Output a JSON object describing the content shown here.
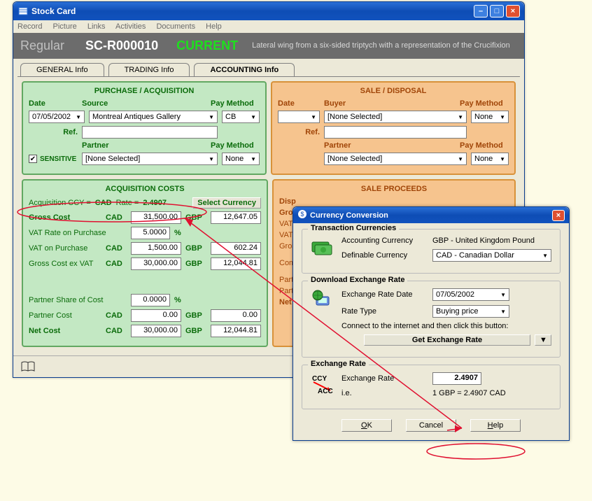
{
  "main_window": {
    "title": "Stock Card",
    "menu": [
      "Record",
      "Picture",
      "Links",
      "Activities",
      "Documents",
      "Help"
    ],
    "header": {
      "regular": "Regular",
      "code": "SC-R000010",
      "status": "CURRENT",
      "description": "Lateral wing from a six-sided triptych with a representation of the Crucifixion"
    },
    "tabs": [
      {
        "label": "GENERAL Info"
      },
      {
        "label": "TRADING Info"
      },
      {
        "label": "ACCOUNTING Info"
      }
    ],
    "purchase_panel": {
      "title": "PURCHASE / ACQUISITION",
      "date_lbl": "Date",
      "date_val": "07/05/2002",
      "source_lbl": "Source",
      "source_val": "Montreal Antiques Gallery",
      "paymethod_lbl": "Pay Method",
      "paymethod_val": "CB",
      "ref_lbl": "Ref.",
      "ref_val": "",
      "partner_lbl": "Partner",
      "partner_val": "[None Selected]",
      "paymethod2_val": "None",
      "sensitive_lbl": "SENSITIVE",
      "sensitive_checked": true
    },
    "sale_panel": {
      "title": "SALE / DISPOSAL",
      "date_lbl": "Date",
      "date_val": "",
      "buyer_lbl": "Buyer",
      "buyer_val": "[None Selected]",
      "paymethod_lbl": "Pay Method",
      "paymethod_val": "None",
      "ref_lbl": "Ref.",
      "ref_val": "",
      "partner_lbl": "Partner",
      "partner_val": "[None Selected]",
      "paymethod2_val": "None"
    },
    "acq_costs": {
      "title": "ACQUISITION COSTS",
      "rate_line_lbl1": "Acquisition CCY  =",
      "rate_ccy": "CAD",
      "rate_line_lbl2": "Rate  =",
      "rate_val": "2.4907",
      "select_btn": "Select Currency",
      "gross_cost_lbl": "Gross Cost",
      "ccy1": "CAD",
      "gross_cost_cad": "31,500.00",
      "ccy2": "GBP",
      "gross_cost_gbp": "12,647.05",
      "vat_rate_lbl": "VAT Rate on Purchase",
      "vat_rate_val": "5.0000",
      "pct": "%",
      "vat_on_lbl": "VAT on Purchase",
      "vat_on_cad": "1,500.00",
      "vat_on_gbp": "602.24",
      "gross_ex_lbl": "Gross Cost ex VAT",
      "gross_ex_cad": "30,000.00",
      "gross_ex_gbp": "12,044.81",
      "partner_share_lbl": "Partner Share of Cost",
      "partner_share_val": "0.0000",
      "partner_cost_lbl": "Partner Cost",
      "partner_cost_cad": "0.00",
      "partner_cost_gbp": "0.00",
      "net_cost_lbl": "Net Cost",
      "net_cost_cad": "30,000.00",
      "net_cost_gbp": "12,044.81"
    },
    "sale_proceeds": {
      "title": "SALE PROCEEDS",
      "disp_lbl": "Disp",
      "gross_lbl": "Gros",
      "vat_lbl": "VAT",
      "vat2_lbl": "VAT",
      "gross2_lbl": "Gros",
      "com_lbl": "Com",
      "part_lbl": "Part",
      "part2_lbl": "Part",
      "net_lbl": "Net"
    }
  },
  "dialog": {
    "title": "Currency Conversion",
    "fs1": {
      "legend": "Transaction Currencies",
      "acc_lbl": "Accounting Currency",
      "acc_val": "GBP - United Kingdom Pound",
      "def_lbl": "Definable Currency",
      "def_val": "CAD - Canadian Dollar"
    },
    "fs2": {
      "legend": "Download Exchange Rate",
      "date_lbl": "Exchange Rate Date",
      "date_val": "07/05/2002",
      "type_lbl": "Rate Type",
      "type_val": "Buying price",
      "connect_lbl": "Connect to the internet and then click this button:",
      "get_btn": "Get Exchange Rate"
    },
    "fs3": {
      "legend": "Exchange Rate",
      "rate_lbl": "Exchange Rate",
      "rate_val": "2.4907",
      "ie_lbl": "i.e.",
      "ie_val": "1 GBP = 2.4907 CAD"
    },
    "buttons": {
      "ok": "OK",
      "cancel": "Cancel",
      "help": "Help"
    }
  }
}
